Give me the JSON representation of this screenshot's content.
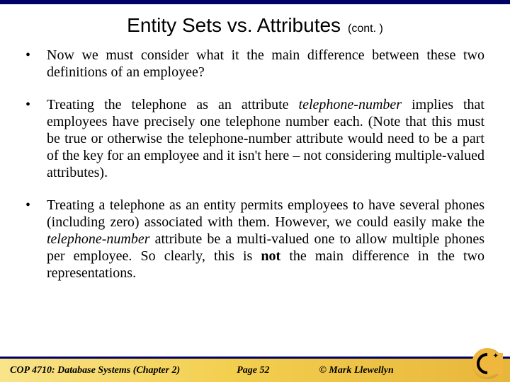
{
  "header": {
    "title_main": "Entity Sets vs. Attributes",
    "title_cont": "(cont. )"
  },
  "bullets": {
    "b1": "Now we must consider what it the main difference between these two definitions of an employee?",
    "b2_a": "Treating the telephone as an attribute ",
    "b2_ital": "telephone-number",
    "b2_b": " implies that employees have precisely one telephone number each.  (Note that this must be true or otherwise the telephone-number attribute would need to be a part of the key for an employee and it isn't here – not considering multiple-valued attributes).",
    "b3_a": "Treating a telephone as an entity permits employees to have several phones (including zero) associated with them.  However, we could easily make the ",
    "b3_ital": "telephone-number",
    "b3_b": " attribute be a multi-valued one to allow multiple phones per employee.  So clearly, this is ",
    "b3_bold": "not",
    "b3_c": " the main difference in the two representations."
  },
  "footer": {
    "course": "COP 4710: Database Systems  (Chapter 2)",
    "page": "Page 52",
    "copy": "© Mark Llewellyn"
  }
}
